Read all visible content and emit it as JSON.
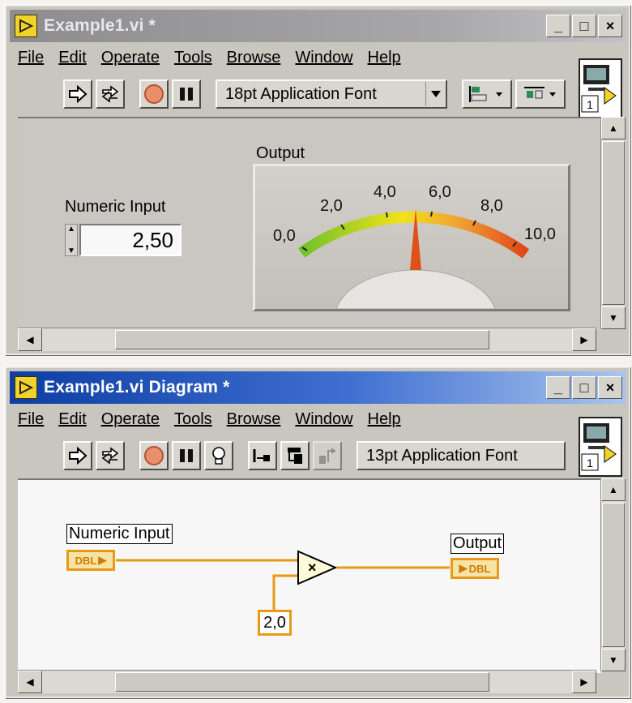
{
  "front_panel": {
    "title": "Example1.vi *",
    "menu": [
      "File",
      "Edit",
      "Operate",
      "Tools",
      "Browse",
      "Window",
      "Help"
    ],
    "font_select": "18pt Application Font",
    "vi_icon_number": "1",
    "numeric_input": {
      "label": "Numeric Input",
      "value": "2,50"
    },
    "gauge": {
      "label": "Output",
      "scale_labels": [
        "0,0",
        "2,0",
        "4,0",
        "6,0",
        "8,0",
        "10,0"
      ],
      "value": 5.0
    }
  },
  "diagram": {
    "title": "Example1.vi Diagram *",
    "menu": [
      "File",
      "Edit",
      "Operate",
      "Tools",
      "Browse",
      "Window",
      "Help"
    ],
    "font_select": "13pt Application Font",
    "vi_icon_number": "1",
    "input_terminal": {
      "label": "Numeric Input",
      "type": "DBL"
    },
    "output_terminal": {
      "label": "Output",
      "type": "DBL"
    },
    "multiply_symbol": "×",
    "constant": "2,0"
  },
  "window_buttons": {
    "minimize": "_",
    "maximize": "□",
    "close": "×"
  },
  "colors": {
    "wire": "#e89a16",
    "active_title": "#0d3ea3",
    "inactive_title": "#8d8c8e",
    "needle": "#e0511a"
  }
}
